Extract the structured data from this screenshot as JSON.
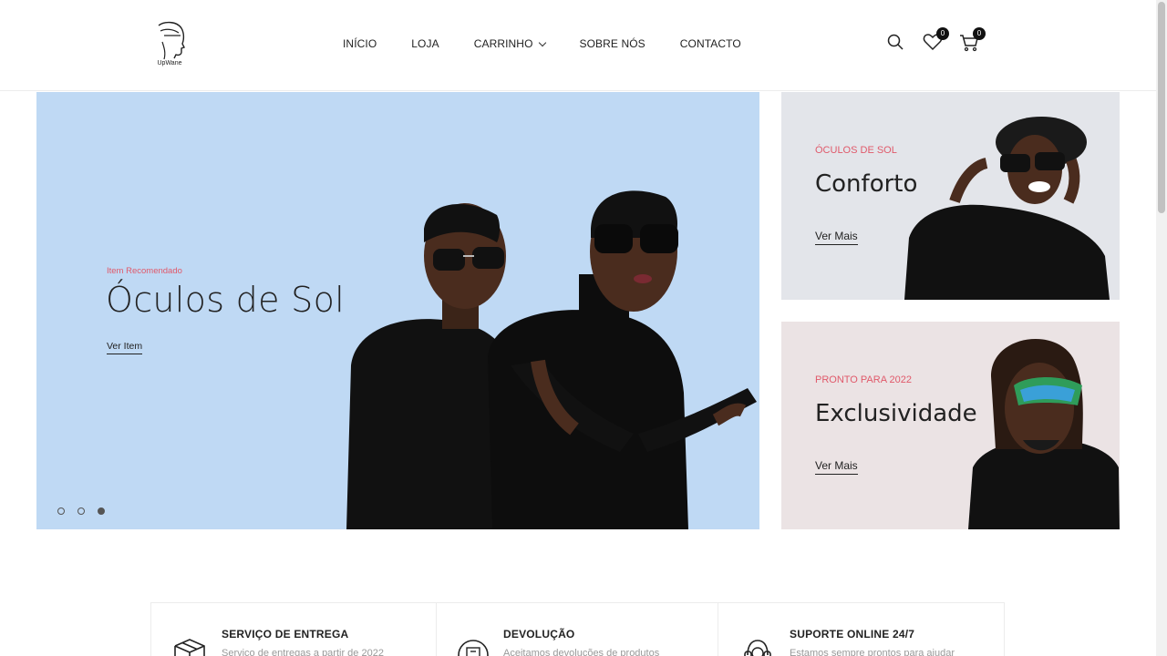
{
  "header": {
    "logo_text": "UpWane",
    "nav": [
      {
        "label": "INÍCIO"
      },
      {
        "label": "LOJA"
      },
      {
        "label": "CARRINHO"
      },
      {
        "label": "SOBRE NÓS"
      },
      {
        "label": "CONTACTO"
      }
    ],
    "wishlist_count": "0",
    "cart_count": "0"
  },
  "hero": {
    "subtitle": "Item Recomendado",
    "title": "Óculos de Sol",
    "link": "Ver Item",
    "slides": 3,
    "active_slide": 3,
    "bg_color": "#bfd9f4"
  },
  "banners": [
    {
      "subtitle": "ÓCULOS DE SOL",
      "title": "Conforto",
      "link": "Ver Mais",
      "bg_color": "#e3e5ea"
    },
    {
      "subtitle": "PRONTO PARA 2022",
      "title": "Exclusividade",
      "link": "Ver Mais",
      "bg_color": "#ebe3e4"
    }
  ],
  "features": [
    {
      "title": "SERVIÇO DE ENTREGA",
      "desc": "Serviço de entregas a partir de 2022",
      "icon": "box-icon"
    },
    {
      "title": "DEVOLUÇÃO",
      "desc": "Aceitamos devoluções de produtos",
      "icon": "return-box-icon"
    },
    {
      "title": "SUPORTE ONLINE 24/7",
      "desc": "Estamos sempre prontos para ajudar",
      "icon": "headset-icon"
    }
  ],
  "colors": {
    "accent": "#e0596a",
    "text": "#222222"
  }
}
